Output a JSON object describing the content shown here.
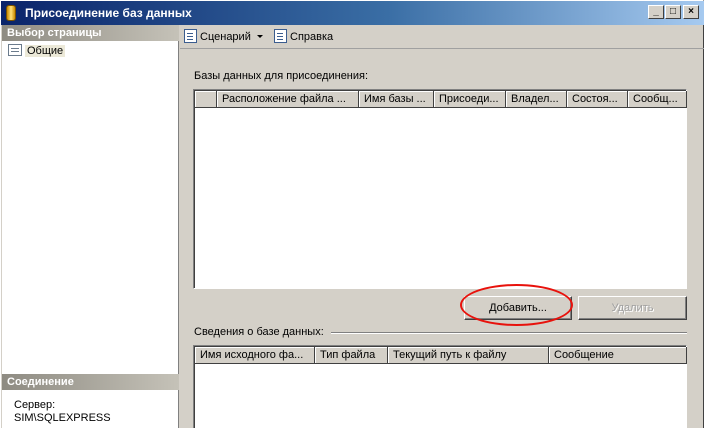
{
  "window": {
    "title": "Присоединение баз данных",
    "controls": [
      "_",
      "□",
      "×"
    ]
  },
  "left_pane": {
    "select_page_header": "Выбор страницы",
    "pages": [
      {
        "label": "Общие",
        "icon": "page-icon"
      }
    ],
    "connection_header": "Соединение",
    "server_label": "Сервер:",
    "server_value": "SIM\\SQLEXPRESS"
  },
  "toolbar": {
    "script_label": "Сценарий",
    "script_icon": "script-icon",
    "help_label": "Справка",
    "help_icon": "help-icon"
  },
  "attach": {
    "label": "Базы данных для присоединения:",
    "columns": [
      "",
      "Расположение файла ...",
      "Имя базы ...",
      "Присоеди...",
      "Владел...",
      "Состоя...",
      "Сообщ..."
    ],
    "rows": []
  },
  "buttons": {
    "add_label": "Добавить...",
    "remove_label": "Удалить"
  },
  "details": {
    "label": "Сведения о базе данных:",
    "columns": [
      "Имя исходного фа...",
      "Тип файла",
      "Текущий путь к файлу",
      "Сообщение"
    ],
    "rows": []
  },
  "annotation": {
    "color": "#e8120c"
  }
}
